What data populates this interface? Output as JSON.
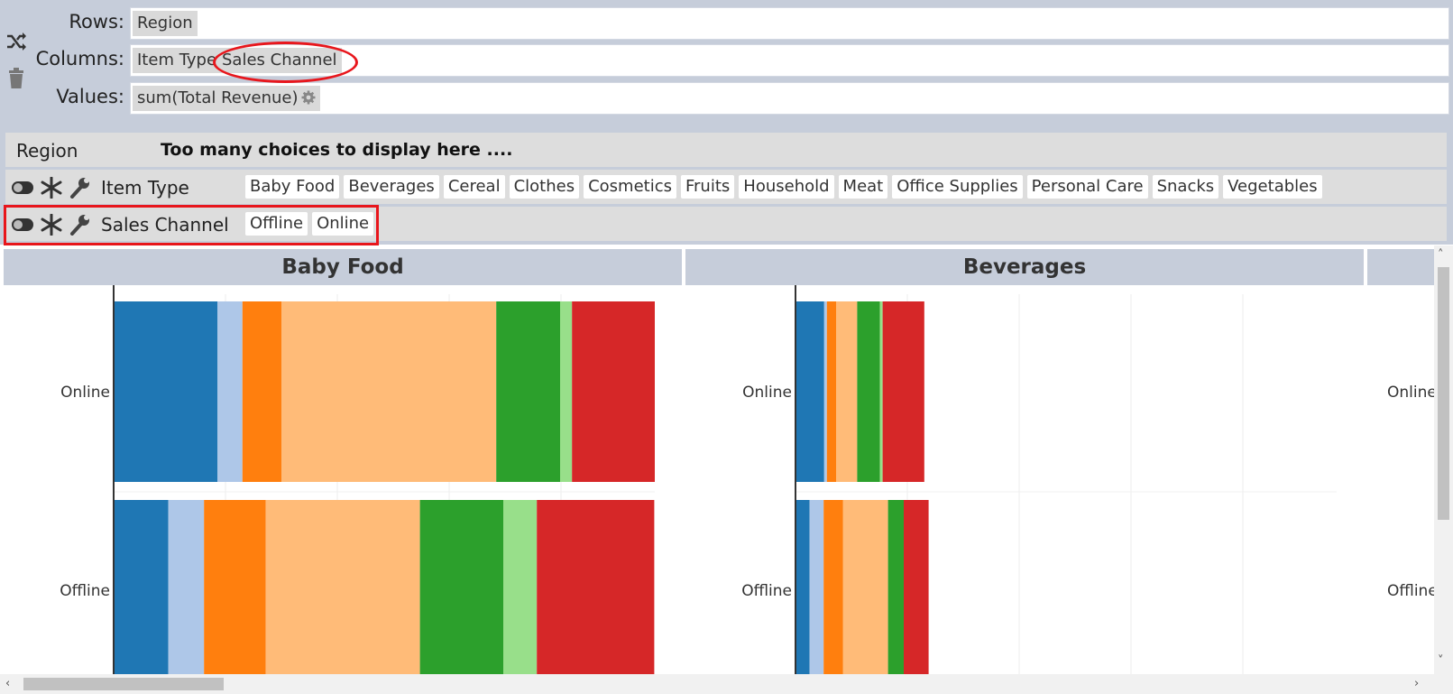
{
  "config": {
    "rows_label": "Rows:",
    "columns_label": "Columns:",
    "values_label": "Values:",
    "rows_chips": [
      "Region"
    ],
    "column_chips": [
      "Item Type",
      "Sales Channel"
    ],
    "value_chips": [
      "sum(Total Revenue)"
    ]
  },
  "filters": {
    "region_label": "Region",
    "region_message": "Too many choices to display here ....",
    "item_type_label": "Item Type",
    "item_type_values": [
      "Baby Food",
      "Beverages",
      "Cereal",
      "Clothes",
      "Cosmetics",
      "Fruits",
      "Household",
      "Meat",
      "Office Supplies",
      "Personal Care",
      "Snacks",
      "Vegetables"
    ],
    "sales_channel_label": "Sales Channel",
    "sales_channel_values": [
      "Offline",
      "Online"
    ]
  },
  "icons": {
    "shuffle": "shuffle-icon",
    "trash": "trash-icon",
    "gear": "gear-icon",
    "toggle": "toggle-icon",
    "asterisk": "asterisk-icon",
    "wrench": "wrench-icon"
  },
  "colors": {
    "segments": [
      "#1f77b4",
      "#aec7e8",
      "#ff7f0e",
      "#ffbb78",
      "#2ca02c",
      "#98df8a",
      "#d62728"
    ],
    "highlight": "#e8161c",
    "header_bg": "#c6cdda"
  },
  "chart_data": {
    "type": "bar",
    "orientation": "horizontal",
    "stacked": true,
    "note_values_are_relative": "segment widths estimated as shares of Baby Food online total",
    "panels": [
      {
        "title": "Baby Food",
        "categories": [
          "Online",
          "Offline"
        ],
        "segments": [
          [
            0.192,
            0.046,
            0.072,
            0.397,
            0.118,
            0.022,
            0.153
          ],
          [
            0.101,
            0.066,
            0.114,
            0.285,
            0.154,
            0.062,
            0.217
          ]
        ]
      },
      {
        "title": "Beverages",
        "categories": [
          "Online",
          "Offline"
        ],
        "segments": [
          [
            0.053,
            0.005,
            0.017,
            0.039,
            0.042,
            0.005,
            0.077
          ],
          [
            0.026,
            0.026,
            0.036,
            0.083,
            0.029,
            0.0,
            0.046
          ]
        ]
      }
    ]
  }
}
